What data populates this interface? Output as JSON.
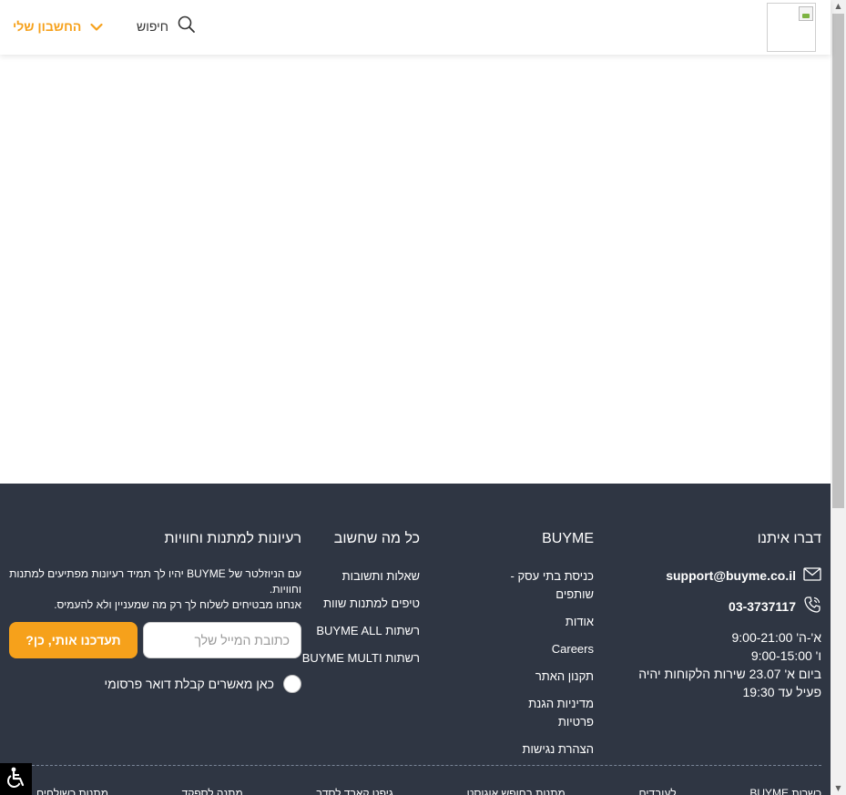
{
  "header": {
    "search_label": "חיפוש",
    "account_label": "החשבון שלי",
    "accent_color": "#f6a11b"
  },
  "footer": {
    "background": "#2f3643",
    "contact": {
      "title": "דברו איתנו",
      "email": "support@buyme.co.il",
      "phone": "03-3737117",
      "hours_1": "א'-ה' 9:00-21:00",
      "hours_2": "ו' 9:00-15:00",
      "hours_3": "ביום א' 23.07 שירות הלקוחות יהיה פעיל עד 19:30"
    },
    "buyme": {
      "title": "BUYME",
      "links": [
        "כניסת בתי עסק - שותפים",
        "אודות",
        "Careers",
        "תקנון האתר",
        "מדיניות הגנת פרטיות",
        "הצהרת נגישות"
      ]
    },
    "think": {
      "title": "כל מה שחשוב",
      "links": [
        "שאלות ותשובות",
        "טיפים למתנות שוות",
        "רשתות BUYME ALL",
        "רשתות BUYME MULTI"
      ]
    },
    "newsletter": {
      "title": "רעיונות למתנות וחוויות",
      "text_1": "עם הניוזלטר של BUYME יהיו לך תמיד רעיונות מפתיעים למתנות וחוויות.",
      "text_2": "אנחנו מבטיחים לשלוח לך רק מה שמעניין ולא להעמיס.",
      "email_placeholder": "כתובת המייל שלך",
      "button_label": "תעדכנו אותי, כן?",
      "consent_label": "כאן מאשרים קבלת דואר פרסומי"
    },
    "bottom_links": [
      "כשרות BUYME",
      "לעובדים",
      "מתנות בחופש אוגוסט",
      "גיפט קארד לסדר",
      "מתנה לספקד",
      "מתנות כשולחים"
    ]
  }
}
